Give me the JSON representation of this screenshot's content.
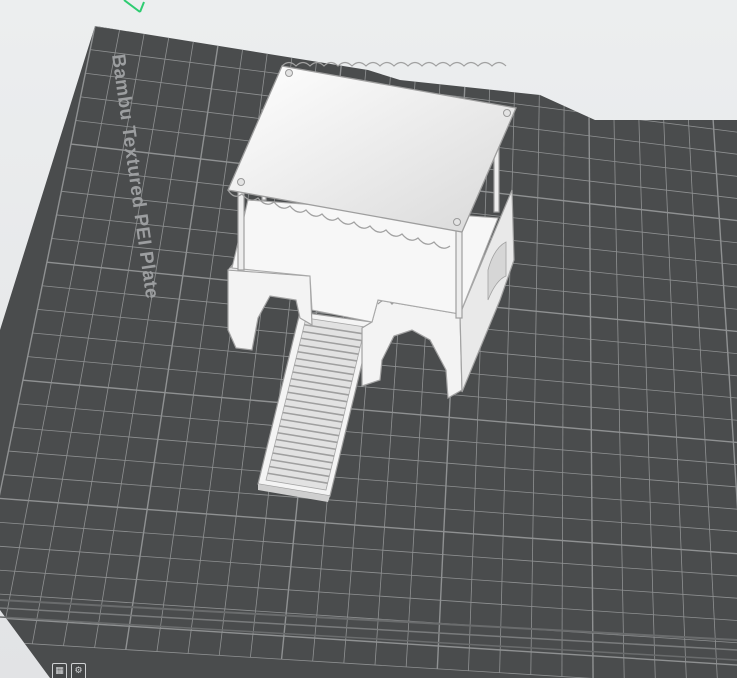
{
  "plate": {
    "label": "Bambu Textured PEI Plate",
    "plate_color": "#4a4c4d",
    "grid_color": "#8f9192",
    "label_color": "#9c9ea0"
  },
  "model": {
    "name": "hamster-house-with-ramp",
    "color": "#f3f3f3"
  },
  "axis": {
    "color": "#2ecc71"
  },
  "toolbar": {
    "icons": [
      "grid-view-icon",
      "plate-settings-icon"
    ]
  }
}
